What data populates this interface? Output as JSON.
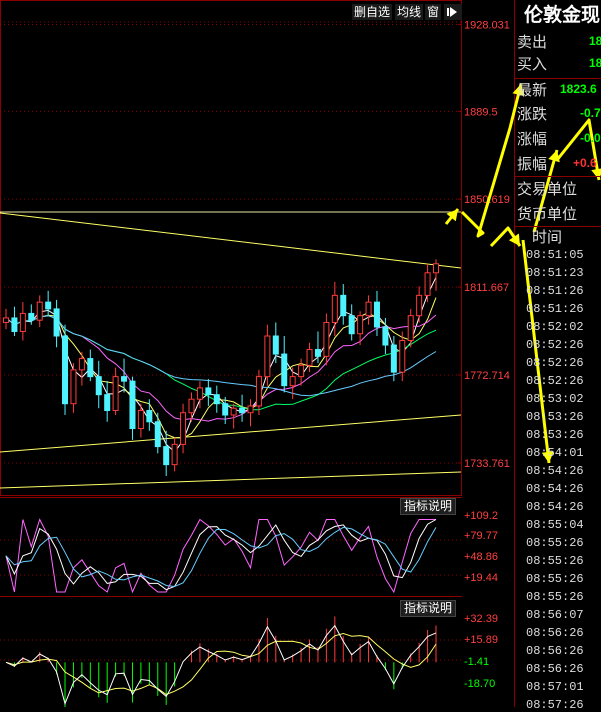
{
  "toolbar": {
    "delete_label": "删自选",
    "ma_label": "均线",
    "window_label": "窗",
    "play_icon": "play-icon"
  },
  "chart_data": [
    {
      "type": "candlestick",
      "panel": "price",
      "ylim": [
        1720,
        1930
      ],
      "right_axis_ticks": [
        "1928.031",
        "1889.5",
        "1850.619",
        "1811.667",
        "1772.714",
        "1733.761"
      ],
      "candles": [
        [
          1796,
          1802,
          1793,
          1798
        ],
        [
          1798,
          1803,
          1790,
          1792
        ],
        [
          1792,
          1805,
          1788,
          1800
        ],
        [
          1800,
          1804,
          1795,
          1797
        ],
        [
          1797,
          1808,
          1794,
          1805
        ],
        [
          1805,
          1810,
          1799,
          1802
        ],
        [
          1802,
          1806,
          1785,
          1790
        ],
        [
          1790,
          1795,
          1755,
          1760
        ],
        [
          1760,
          1778,
          1756,
          1775
        ],
        [
          1775,
          1783,
          1768,
          1780
        ],
        [
          1780,
          1784,
          1770,
          1772
        ],
        [
          1772,
          1779,
          1758,
          1764
        ],
        [
          1764,
          1770,
          1752,
          1757
        ],
        [
          1757,
          1776,
          1755,
          1772
        ],
        [
          1772,
          1780,
          1765,
          1770
        ],
        [
          1770,
          1772,
          1744,
          1749
        ],
        [
          1749,
          1760,
          1745,
          1757
        ],
        [
          1757,
          1762,
          1748,
          1752
        ],
        [
          1752,
          1756,
          1738,
          1741
        ],
        [
          1741,
          1748,
          1728,
          1733
        ],
        [
          1733,
          1745,
          1730,
          1742
        ],
        [
          1742,
          1760,
          1738,
          1756
        ],
        [
          1756,
          1765,
          1752,
          1762
        ],
        [
          1762,
          1770,
          1758,
          1767
        ],
        [
          1767,
          1771,
          1759,
          1764
        ],
        [
          1764,
          1768,
          1756,
          1760
        ],
        [
          1760,
          1763,
          1751,
          1755
        ],
        [
          1755,
          1760,
          1749,
          1758
        ],
        [
          1758,
          1764,
          1752,
          1756
        ],
        [
          1756,
          1762,
          1750,
          1759
        ],
        [
          1759,
          1775,
          1755,
          1772
        ],
        [
          1772,
          1795,
          1768,
          1790
        ],
        [
          1790,
          1796,
          1778,
          1782
        ],
        [
          1782,
          1790,
          1765,
          1768
        ],
        [
          1768,
          1776,
          1762,
          1772
        ],
        [
          1772,
          1780,
          1768,
          1777
        ],
        [
          1777,
          1787,
          1774,
          1784
        ],
        [
          1784,
          1792,
          1778,
          1781
        ],
        [
          1781,
          1800,
          1777,
          1796
        ],
        [
          1796,
          1814,
          1790,
          1808
        ],
        [
          1808,
          1813,
          1795,
          1799
        ],
        [
          1799,
          1804,
          1788,
          1791
        ],
        [
          1791,
          1801,
          1786,
          1799
        ],
        [
          1799,
          1808,
          1795,
          1805
        ],
        [
          1805,
          1810,
          1790,
          1794
        ],
        [
          1794,
          1798,
          1782,
          1786
        ],
        [
          1786,
          1790,
          1770,
          1774
        ],
        [
          1774,
          1792,
          1770,
          1788
        ],
        [
          1788,
          1802,
          1785,
          1799
        ],
        [
          1799,
          1812,
          1796,
          1808
        ],
        [
          1808,
          1822,
          1805,
          1818
        ],
        [
          1818,
          1824,
          1810,
          1822
        ]
      ]
    },
    {
      "type": "line",
      "panel": "indicator-1",
      "indicator_label": "指标说明",
      "right_axis_ticks": [
        "+109.2",
        "+79.77",
        "+48.86",
        "+19.44"
      ],
      "ylim": [
        0,
        120
      ]
    },
    {
      "type": "bar",
      "panel": "indicator-2",
      "indicator_label": "指标说明",
      "right_axis_ticks": [
        "+32.39",
        "+15.89",
        "-1.41",
        "-18.70"
      ],
      "ylim": [
        -25,
        40
      ]
    }
  ],
  "quote_panel": {
    "title": "伦敦金现",
    "rows": [
      {
        "label": "卖出",
        "value": "18",
        "color": "#00ff00"
      },
      {
        "label": "买入",
        "value": "18",
        "color": "#00ff00"
      },
      {
        "label": "最新",
        "value": "1823.6",
        "color": "#00ff00"
      },
      {
        "label": "涨跌",
        "value": "-0.7",
        "color": "#00ff00"
      },
      {
        "label": "涨幅",
        "value": "-0.0",
        "color": "#00ff00"
      },
      {
        "label": "振幅",
        "value": "+0.6",
        "color": "#ff3333"
      },
      {
        "label": "交易单位",
        "value": "",
        "color": "#dddddd"
      },
      {
        "label": "货币单位",
        "value": "",
        "color": "#dddddd"
      }
    ]
  },
  "time_list": {
    "header": "时间",
    "items": [
      "08:51:05",
      "08:51:23",
      "08:51:26",
      "08:51:26",
      "08:52:02",
      "08:52:26",
      "08:52:26",
      "08:52:26",
      "08:53:02",
      "08:53:26",
      "08:53:26",
      "08:54:01",
      "08:54:26",
      "08:54:26",
      "08:54:26",
      "08:55:04",
      "08:55:26",
      "08:55:26",
      "08:55:26",
      "08:55:26",
      "08:56:07",
      "08:56:26",
      "08:56:26",
      "08:56:26",
      "08:57:01",
      "08:57:26"
    ]
  },
  "colors": {
    "grid_red": "#8b0000",
    "up_candle": "#ff3b3b",
    "down_candle": "#4ff3ff",
    "trend_line": "#ffff66",
    "annotation_yellow": "#ffff00"
  }
}
